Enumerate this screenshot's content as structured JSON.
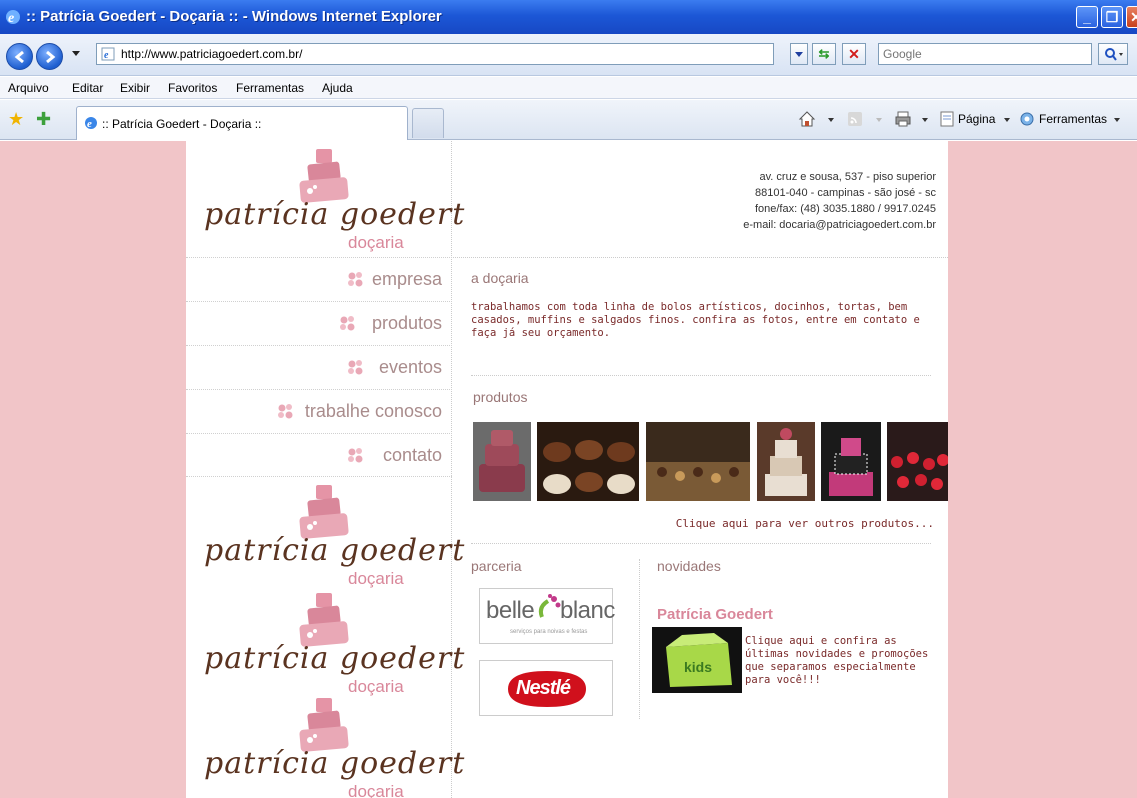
{
  "window": {
    "title": ":: Patrícia Goedert - Doçaria :: - Windows Internet Explorer"
  },
  "address_bar": {
    "url": "http://www.patriciagoedert.com.br/",
    "search_placeholder": "Google"
  },
  "menu": [
    "Arquivo",
    "Editar",
    "Exibir",
    "Favoritos",
    "Ferramentas",
    "Ajuda"
  ],
  "tab": {
    "label": ":: Patrícia Goedert - Doçaria ::"
  },
  "command_bar": {
    "page_label": "Página",
    "tools_label": "Ferramentas"
  },
  "site": {
    "logo": {
      "script": "patrícia goedert",
      "sub": "doçaria"
    },
    "nav": [
      "empresa",
      "produtos",
      "eventos",
      "trabalhe conosco",
      "contato"
    ],
    "address_lines": [
      "av. cruz e sousa, 537 - piso superior",
      "88101-040 - campinas - são josé - sc",
      "fone/fax: (48) 3035.1880 / 9917.0245",
      "e-mail: docaria@patriciagoedert.com.br"
    ],
    "about": {
      "title": "a doçaria",
      "text": "trabalhamos com toda linha de bolos artísticos, docinhos, tortas, bem casados, muffins e salgados finos. confira as fotos, entre em contato e faça já seu orçamento."
    },
    "products": {
      "title": "produtos",
      "more_link": "Clique aqui para ver outros produtos..."
    },
    "partners": {
      "title": "parceria",
      "belle_name_left": "belle",
      "belle_name_right": "blanc",
      "belle_tagline": "serviços para noivas e festas",
      "nestle": "Nestlé"
    },
    "news": {
      "title": "novidades",
      "item_title": "Patrícia Goedert",
      "item_text": "Clique aqui e confira as últimas novidades e promoções que separamos especialmente para você!!!",
      "image_label": "kids"
    }
  },
  "colors": {
    "page_bg": "#f1c5c8",
    "brand_pink": "#d9879a",
    "brand_brown": "#5a3320",
    "titlebar_blue": "#1c57d6"
  }
}
